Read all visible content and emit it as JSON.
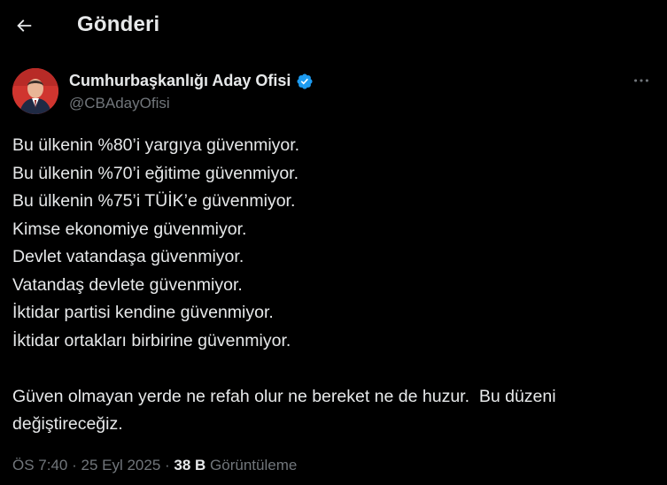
{
  "header": {
    "title": "Gönderi",
    "back_icon": "arrow-left-icon"
  },
  "author": {
    "display_name": "Cumhurbaşkanlığı Aday Ofisi",
    "handle": "@CBAdayOfisi",
    "verified_icon": "verified-badge-icon",
    "verified_color": "#1d9bf0",
    "more_icon": "more-horizontal-icon"
  },
  "tweet": {
    "lines": [
      "Bu ülkenin %80’i yargıya güvenmiyor.",
      "Bu ülkenin %70’i eğitime güvenmiyor.",
      "Bu ülkenin %75’i TÜİK’e güvenmiyor.",
      "Kimse ekonomiye güvenmiyor.",
      "Devlet vatandaşa güvenmiyor.",
      "Vatandaş devlete güvenmiyor.",
      "İktidar partisi kendine güvenmiyor.",
      "İktidar ortakları birbirine güvenmiyor."
    ],
    "closing_line_1": "Güven olmayan yerde ne refah olur ne bereket ne de huzur.  Bu düzeni",
    "closing_line_2": "değiştireceğiz."
  },
  "meta": {
    "time": "ÖS 7:40",
    "separator": " · ",
    "date": "25 Eyl 2025",
    "views_count": "38 B",
    "views_label": "Görüntüleme"
  },
  "colors": {
    "background": "#000000",
    "text": "#e7e9ea",
    "secondary_text": "#71767b",
    "accent": "#1d9bf0"
  }
}
